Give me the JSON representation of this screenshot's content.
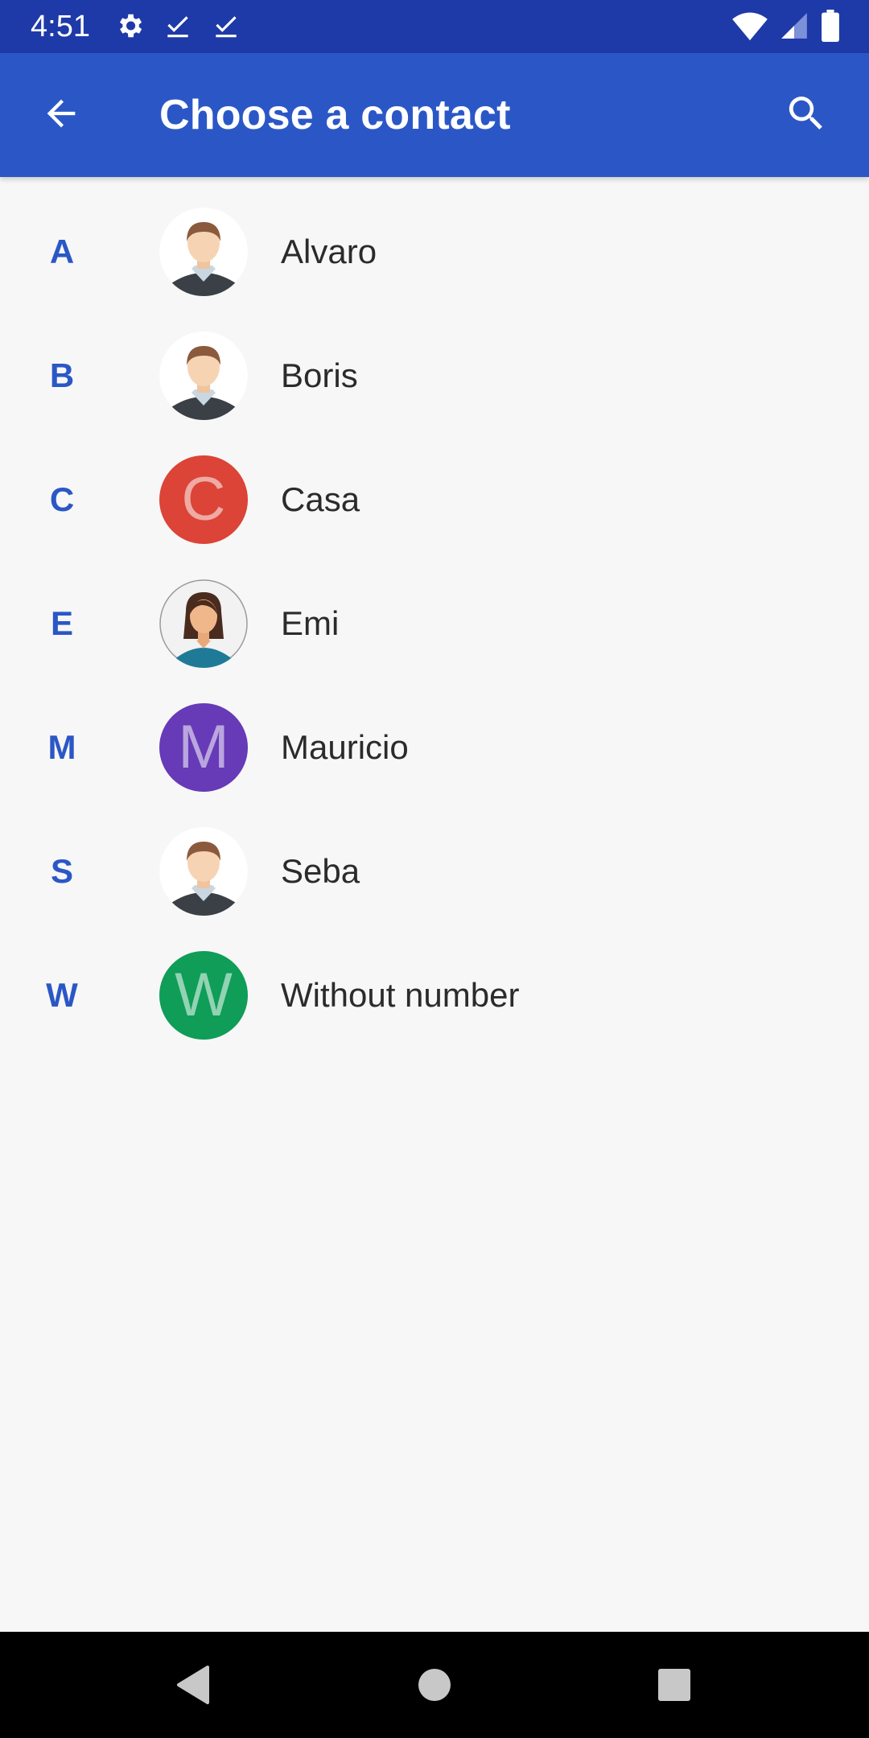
{
  "status_bar": {
    "time": "4:51",
    "left_icons": [
      "gear-icon",
      "check-icon",
      "check-icon"
    ],
    "right_icons": [
      "wifi-icon",
      "signal-icon",
      "battery-icon"
    ]
  },
  "app_bar": {
    "title": "Choose a contact",
    "back_icon": "arrow-back-icon",
    "search_icon": "search-icon",
    "color": "#2b57c6"
  },
  "contacts": [
    {
      "letter": "A",
      "name": "Alvaro",
      "avatar": "male-avatar"
    },
    {
      "letter": "B",
      "name": "Boris",
      "avatar": "male-avatar"
    },
    {
      "letter": "C",
      "name": "Casa",
      "avatar": "initial",
      "initial": "C",
      "color": "#db4437"
    },
    {
      "letter": "E",
      "name": "Emi",
      "avatar": "female-avatar"
    },
    {
      "letter": "M",
      "name": "Mauricio",
      "avatar": "initial",
      "initial": "M",
      "color": "#673ab7"
    },
    {
      "letter": "S",
      "name": "Seba",
      "avatar": "male-avatar"
    },
    {
      "letter": "W",
      "name": "Without number",
      "avatar": "initial",
      "initial": "W",
      "color": "#0f9d58"
    }
  ],
  "nav_bar": {
    "icons": [
      "nav-back-icon",
      "nav-home-icon",
      "nav-recents-icon"
    ]
  }
}
